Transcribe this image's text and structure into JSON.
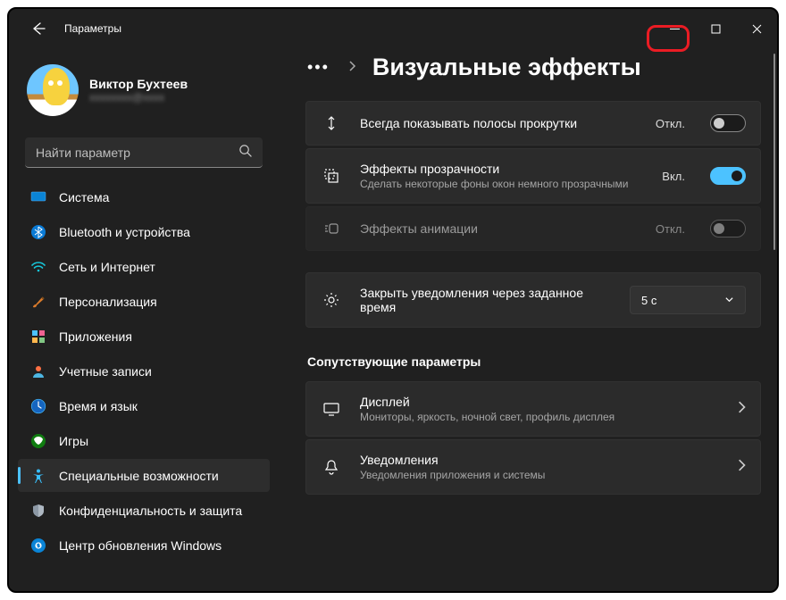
{
  "window": {
    "title": "Параметры"
  },
  "user": {
    "name": "Виктор Бухтеев",
    "email": "xxxxxxxx@xxxx"
  },
  "search": {
    "placeholder": "Найти параметр"
  },
  "sidebar": {
    "items": [
      {
        "label": "Система"
      },
      {
        "label": "Bluetooth и устройства"
      },
      {
        "label": "Сеть и Интернет"
      },
      {
        "label": "Персонализация"
      },
      {
        "label": "Приложения"
      },
      {
        "label": "Учетные записи"
      },
      {
        "label": "Время и язык"
      },
      {
        "label": "Игры"
      },
      {
        "label": "Специальные возможности"
      },
      {
        "label": "Конфиденциальность и защита"
      },
      {
        "label": "Центр обновления Windows"
      }
    ],
    "selected_index": 8
  },
  "page": {
    "title": "Визуальные эффекты"
  },
  "settings": {
    "scroll": {
      "title": "Всегда показывать полосы прокрутки",
      "state": "Откл."
    },
    "transparency": {
      "title": "Эффекты прозрачности",
      "sub": "Сделать некоторые фоны окон немного прозрачными",
      "state": "Вкл."
    },
    "animation": {
      "title": "Эффекты анимации",
      "state": "Откл."
    },
    "dismiss": {
      "title": "Закрыть уведомления через заданное время",
      "value": "5 с"
    }
  },
  "related": {
    "heading": "Сопутствующие параметры",
    "display": {
      "title": "Дисплей",
      "sub": "Мониторы, яркость, ночной свет, профиль дисплея"
    },
    "notifications": {
      "title": "Уведомления",
      "sub": "Уведомления приложения и системы"
    }
  }
}
